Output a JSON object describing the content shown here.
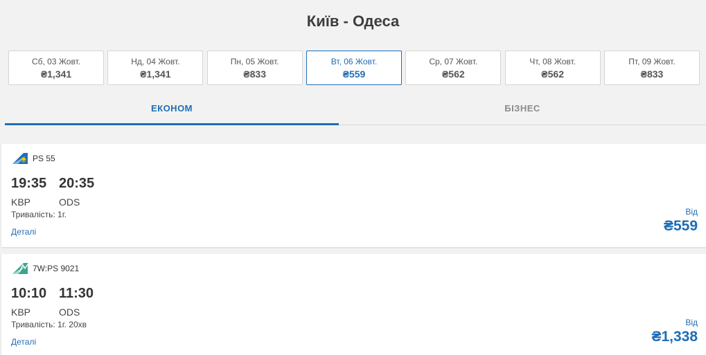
{
  "header": {
    "title": "Київ - Одеса"
  },
  "dates": [
    {
      "label": "Сб, 03 Жовт.",
      "price": "₴1,341"
    },
    {
      "label": "Нд, 04 Жовт.",
      "price": "₴1,341"
    },
    {
      "label": "Пн, 05 Жовт.",
      "price": "₴833"
    },
    {
      "label": "Вт, 06 Жовт.",
      "price": "₴559",
      "selected": true
    },
    {
      "label": "Ср, 07 Жовт.",
      "price": "₴562"
    },
    {
      "label": "Чт, 08 Жовт.",
      "price": "₴562"
    },
    {
      "label": "Пт, 09 Жовт.",
      "price": "₴833"
    }
  ],
  "tabs": [
    {
      "label": "ЕКОНОМ",
      "active": true
    },
    {
      "label": "БІЗНЕС",
      "active": false
    }
  ],
  "flights": [
    {
      "flight_no": "PS 55",
      "airline_icon": "uia-tail-logo-icon",
      "depart_time": "19:35",
      "arrive_time": "20:35",
      "depart_code": "KBP",
      "arrive_code": "ODS",
      "duration": "Тривалість: 1г.",
      "details": "Деталі",
      "from_label": "Від",
      "price": "₴559"
    },
    {
      "flight_no": "7W:PS 9021",
      "airline_icon": "windrose-tail-logo-icon",
      "depart_time": "10:10",
      "arrive_time": "11:30",
      "depart_code": "KBP",
      "arrive_code": "ODS",
      "duration": "Тривалість: 1г. 20хв",
      "details": "Деталі",
      "from_label": "Від",
      "price": "₴1,338"
    }
  ],
  "colors": {
    "accent": "#1f6db5",
    "background": "#f2f2f2"
  }
}
